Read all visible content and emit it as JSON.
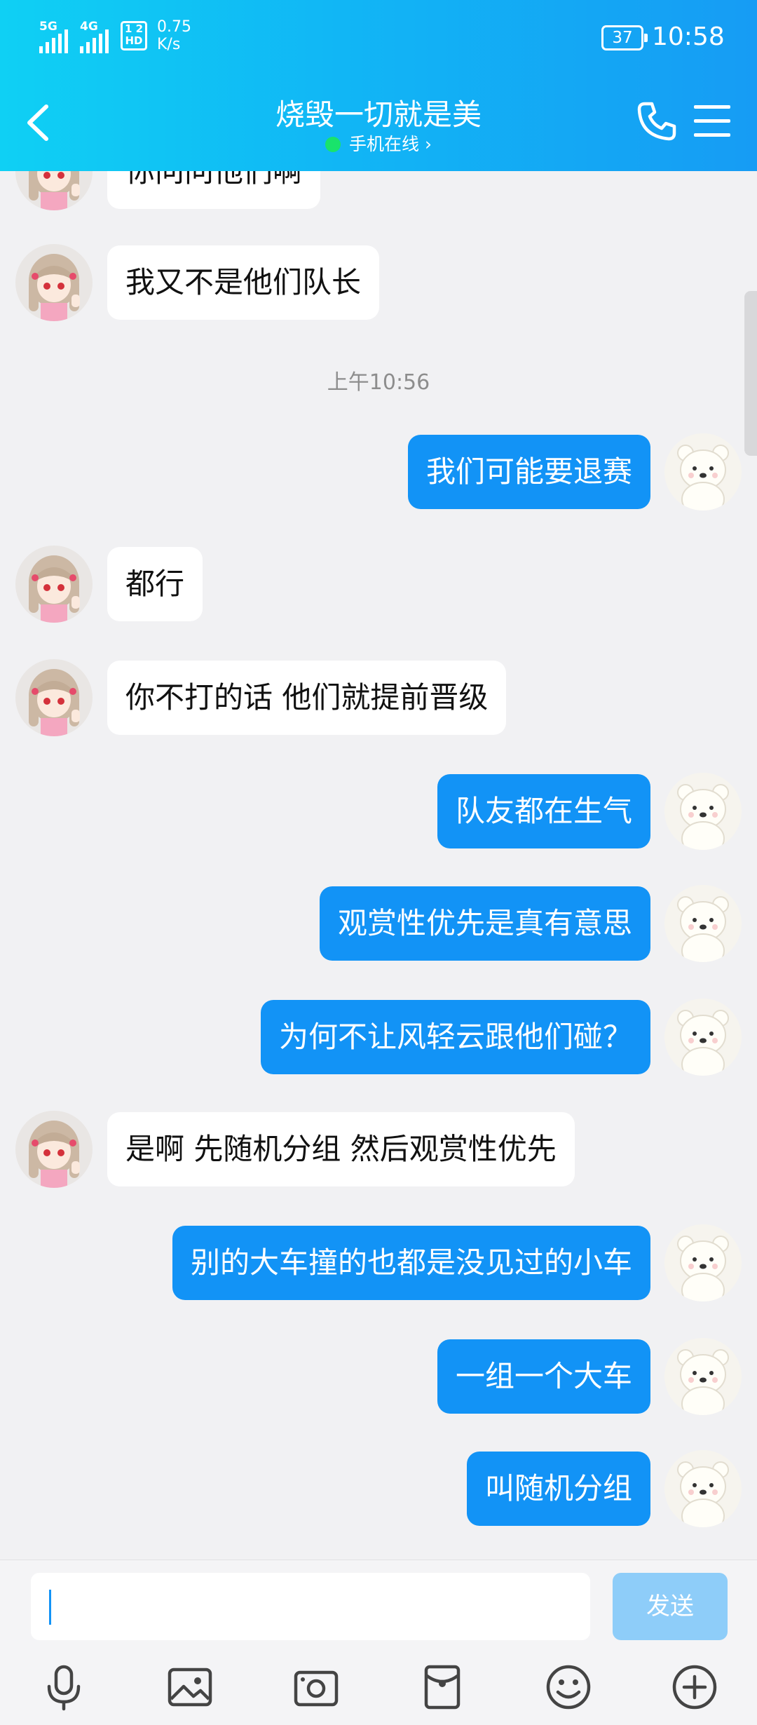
{
  "status_bar": {
    "signal_1": "5G",
    "signal_2": "4G",
    "hd_badge": "1 2\nHD",
    "net_speed": "0.75\nK/s",
    "battery": "37",
    "time": "10:58"
  },
  "header": {
    "title": "烧毁一切就是美",
    "subtitle": "手机在线",
    "subtitle_chevron": "›",
    "colors": {
      "gradient_start": "#0fd0f4",
      "gradient_end": "#169cf4"
    }
  },
  "chat": {
    "timestamp": "上午10:56",
    "messages": [
      {
        "side": "left",
        "text": "你问问他们啊"
      },
      {
        "side": "left",
        "text": "我又不是他们队长"
      },
      {
        "side": "right",
        "text": "我们可能要退赛"
      },
      {
        "side": "left",
        "text": "都行"
      },
      {
        "side": "left",
        "text": "你不打的话 他们就提前晋级"
      },
      {
        "side": "right",
        "text": "队友都在生气"
      },
      {
        "side": "right",
        "text": "观赏性优先是真有意思"
      },
      {
        "side": "right",
        "text": "为何不让风轻云跟他们碰？"
      },
      {
        "side": "left",
        "text": "是啊 先随机分组 然后观赏性优先"
      },
      {
        "side": "right",
        "text": "别的大车撞的也都是没见过的小车"
      },
      {
        "side": "right",
        "text": "一组一个大车"
      },
      {
        "side": "right",
        "text": "叫随机分组"
      }
    ],
    "colors": {
      "sent_bubble": "#1293f6",
      "received_bubble": "#ffffff"
    }
  },
  "composer": {
    "input_value": "",
    "send_label": "发送",
    "tools": [
      "microphone-icon",
      "image-icon",
      "camera-icon",
      "red-packet-icon",
      "emoji-icon",
      "plus-icon"
    ]
  }
}
